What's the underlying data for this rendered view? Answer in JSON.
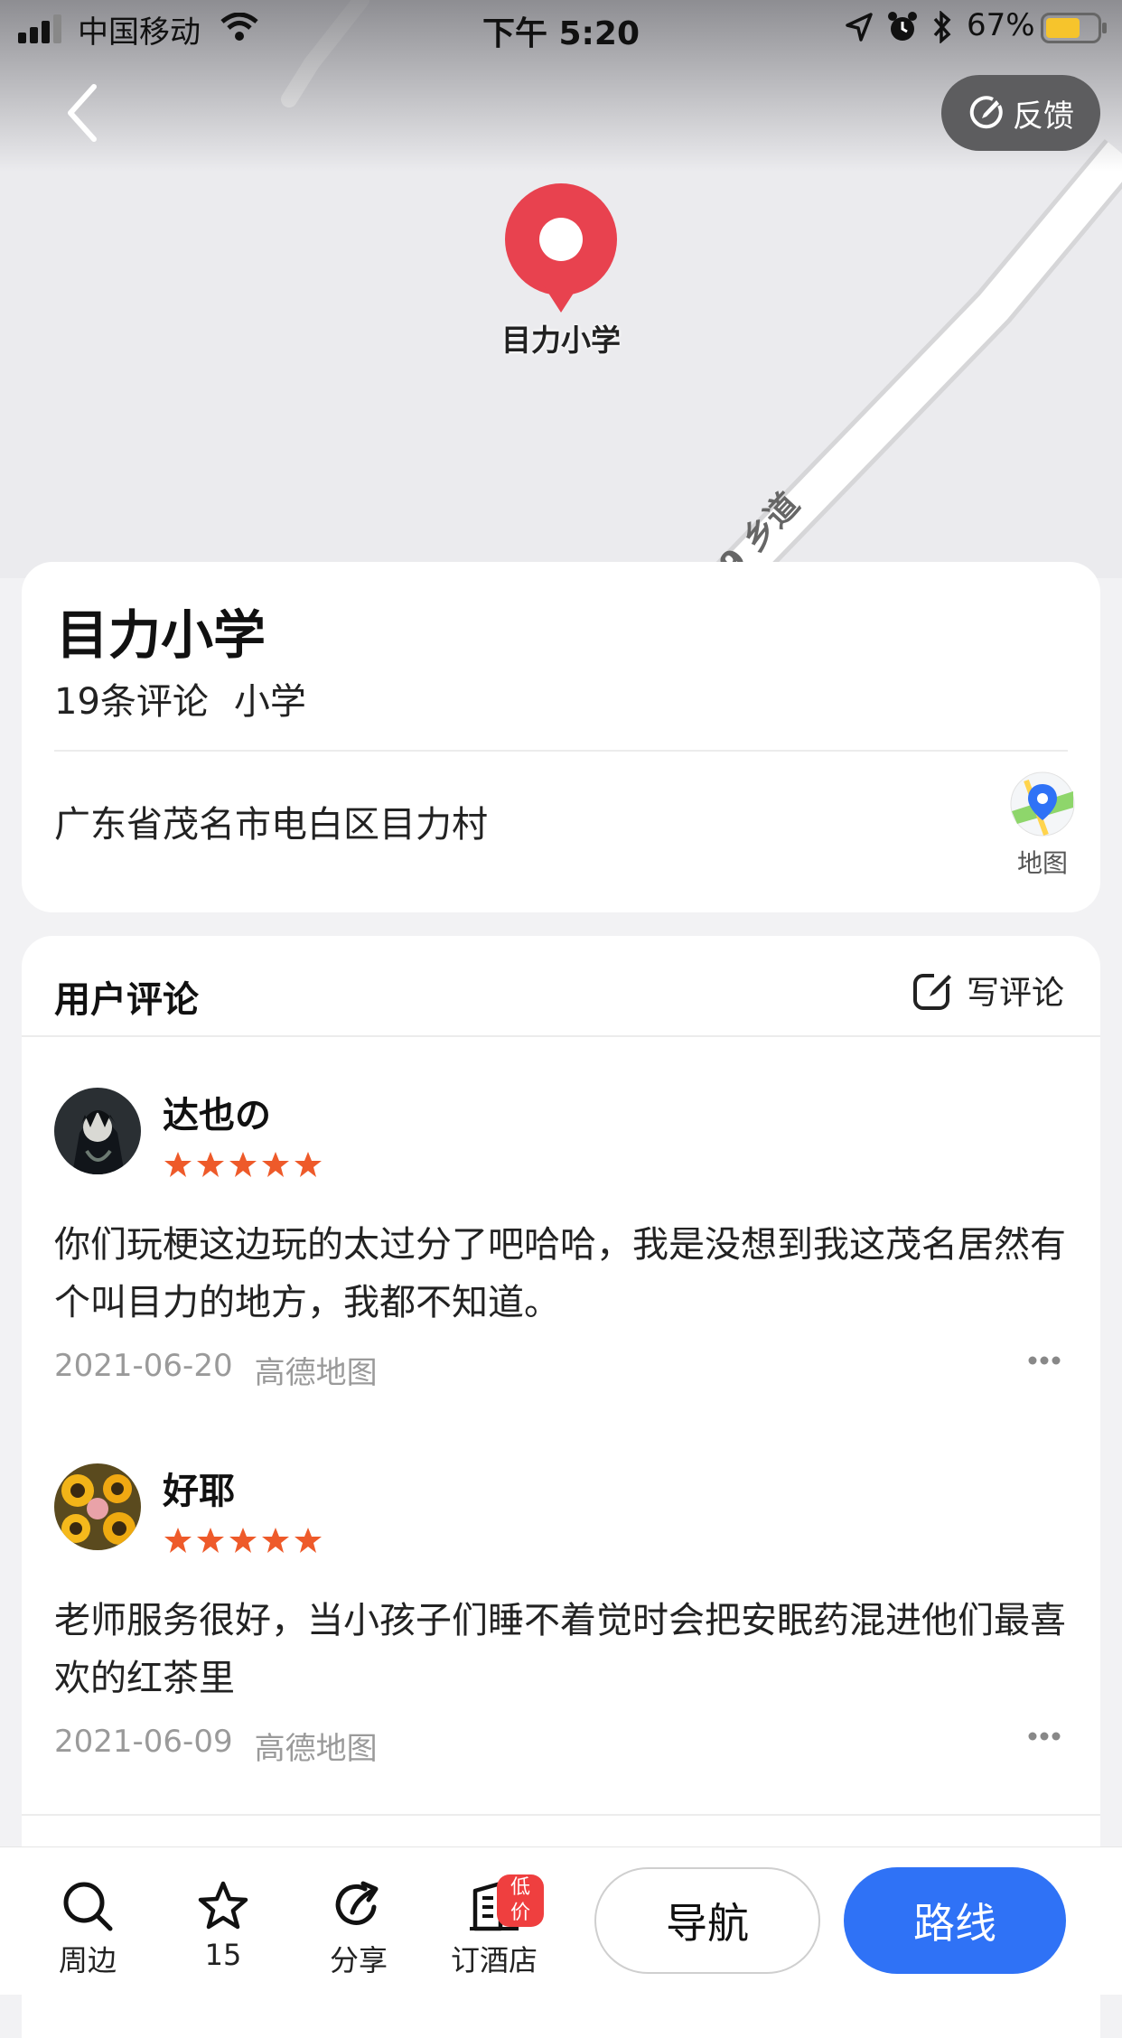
{
  "status_bar": {
    "carrier": "中国移动",
    "time": "下午 5:20",
    "battery_percent": "67%"
  },
  "map": {
    "road_label": "9 乡道",
    "pin_label": "目力小学",
    "pin_color": "#e8424f"
  },
  "header": {
    "feedback_label": "反馈"
  },
  "place": {
    "name": "目力小学",
    "review_count": "19条评论",
    "category": "小学",
    "address": "广东省茂名市电白区目力村",
    "map_label": "地图"
  },
  "reviews": {
    "section_title": "用户评论",
    "write_label": "写评论",
    "items": [
      {
        "user": "达也の",
        "stars": 5,
        "text": "你们玩梗这边玩的太过分了吧哈哈，我是没想到我这茂名居然有个叫目力的地方，我都不知道。",
        "date": "2021-06-20",
        "source": "高德地图",
        "avatar_icon": "dark-character-avatar"
      },
      {
        "user": "好耶",
        "stars": 5,
        "text": "老师服务很好，当小孩子们睡不着觉时会把安眠药混进他们最喜欢的红茶里",
        "date": "2021-06-09",
        "source": "高德地图",
        "avatar_icon": "sunflower-avatar"
      }
    ]
  },
  "bottom_bar": {
    "nearby_label": "周边",
    "favorites_count": "15",
    "share_label": "分享",
    "hotel_label": "订酒店",
    "hotel_badge": "低价",
    "navigate_label": "导航",
    "route_label": "路线",
    "accent_color": "#2f72f6"
  }
}
